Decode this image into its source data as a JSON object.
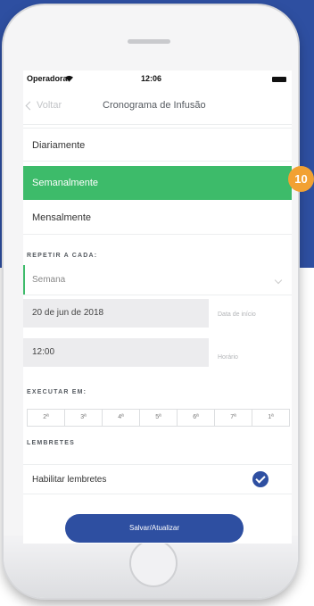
{
  "status_bar": {
    "carrier": "Operadora",
    "time": "12:06"
  },
  "nav": {
    "back_label": "Voltar",
    "title": "Cronograma de Infusão"
  },
  "frequency": {
    "options": [
      "Diariamente",
      "Semanalmente",
      "Mensalmente"
    ],
    "selected": "Semanalmente"
  },
  "repeat": {
    "section_label": "REPETIR A CADA:",
    "unit_value": "Semana",
    "date_value": "20 de jun de 2018",
    "date_caption": "Data de início",
    "time_value": "12:00",
    "time_caption": "Horário"
  },
  "execute": {
    "section_label": "EXECUTAR EM:",
    "days": [
      "2ª",
      "3ª",
      "4ª",
      "5ª",
      "6ª",
      "7ª",
      "1ª"
    ]
  },
  "reminders": {
    "section_label": "LEMBRETES",
    "enable_label": "Habilitar lembretes",
    "enabled": true
  },
  "save_button_label": "Salvar/Atualizar",
  "badge_number": "10",
  "colors": {
    "accent_green": "#3dbb6a",
    "brand_blue": "#2e4fa1",
    "badge_orange": "#f2a132"
  }
}
